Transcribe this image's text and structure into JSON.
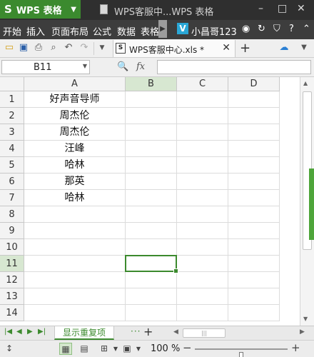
{
  "app": {
    "name": "WPS 表格",
    "logo": "S",
    "window_title": "WPS客服中...WPS 表格"
  },
  "window_controls": [
    "–",
    "□",
    "✕"
  ],
  "menu": {
    "items": [
      "开始",
      "插入",
      "页面布局",
      "公式",
      "数据",
      "表格"
    ],
    "active_index": 4,
    "user": "小昌哥123",
    "user_badge": "V"
  },
  "toolbar": {
    "doc_tab_label": "WPS客服中心.xls *",
    "doc_tab_close": "✕",
    "new_tab": "+"
  },
  "formula_bar": {
    "name_box": "B11",
    "fx": "fx",
    "formula": ""
  },
  "grid": {
    "columns": [
      "A",
      "B",
      "C",
      "D"
    ],
    "selected_column": "B",
    "rows": [
      "1",
      "2",
      "3",
      "4",
      "5",
      "6",
      "7",
      "8",
      "9",
      "10",
      "11",
      "12",
      "13",
      "14"
    ],
    "selected_row": "11",
    "column_a_values": [
      "好声音导师",
      "周杰伦",
      "周杰伦",
      "汪峰",
      "哈林",
      "那英",
      "哈林",
      "",
      "",
      "",
      "",
      "",
      "",
      ""
    ]
  },
  "sheets": {
    "tabs": [
      "显示重复项"
    ],
    "more": "···",
    "add": "+"
  },
  "status": {
    "zoom": "100 %",
    "zoom_level_percent": 100,
    "zoom_minus": "−",
    "zoom_plus": "+"
  },
  "colors": {
    "accent": "#3c8a2e",
    "selected_header": "#d7e7d1",
    "titlebar": "#2f2f2f"
  }
}
